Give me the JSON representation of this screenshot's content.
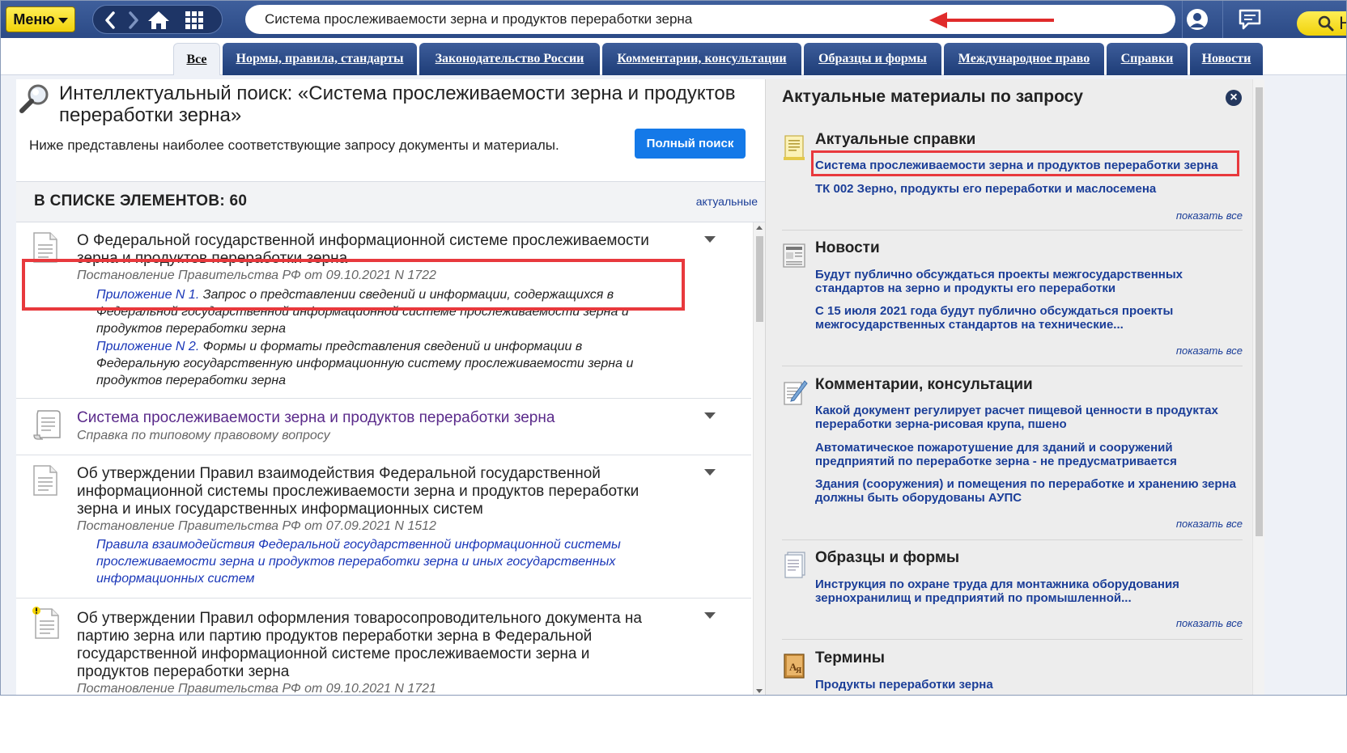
{
  "topbar": {
    "menu_label": "Меню",
    "search_value": "Система прослеживаемости зерна и продуктов переработки зерна",
    "find_label": "Найти",
    "icons": [
      "back-icon",
      "forward-icon",
      "home-icon",
      "grid-icon",
      "search-icon",
      "hamburger-icon",
      "user-icon",
      "chat-icon"
    ]
  },
  "tabs": [
    "Все",
    "Нормы, правила, стандарты",
    "Законодательство России",
    "Комментарии, консультации",
    "Образцы и формы",
    "Международное право",
    "Справки",
    "Новости"
  ],
  "left": {
    "title": "Интеллектуальный поиск: «Система прослеживаемости зерна и продуктов переработки зерна»",
    "subtitle": "Ниже представлены наиболее соответствующие запросу документы и материалы.",
    "full_search_label": "Полный поиск",
    "count_title": "В СПИСКЕ ЭЛЕМЕНТОВ: 60",
    "count_filter": "актуальные",
    "results": [
      {
        "title": "О Федеральной государственной информационной системе прослеживаемости зерна и продуктов переработки зерна",
        "source": "Постановление Правительства РФ от 09.10.2021 N 1722",
        "appendices": [
          {
            "link": "Приложение N 1.",
            "text": " Запрос о представлении сведений и информации, содержащихся в Федеральной государственной информационной системе прослеживаемости зерна и продуктов переработки зерна"
          },
          {
            "link": "Приложение N 2.",
            "text": " Формы и форматы представления сведений и информации в Федеральную государственную информационную систему прослеживаемости зерна и продуктов переработки зерна"
          }
        ]
      },
      {
        "title": "Система прослеживаемости зерна и продуктов переработки зерна",
        "source": "Справка по типовому правовому вопросу"
      },
      {
        "title": "Об утверждении Правил взаимодействия Федеральной государственной информационной системы прослеживаемости зерна и продуктов переработки зерна и иных государственных информационных систем",
        "source": "Постановление Правительства РФ от 07.09.2021 N 1512",
        "appendix_link": "Правила взаимодействия Федеральной государственной информационной системы прослеживаемости зерна и продуктов переработки зерна и иных государственных информационных систем"
      },
      {
        "title": "Об утверждении Правил оформления товаросопроводительного документа на партию зерна или партию продуктов переработки зерна в Федеральной государственной информационной системе прослеживаемости зерна и продуктов переработки зерна",
        "source": "Постановление Правительства РФ от 09.10.2021 N 1721"
      }
    ]
  },
  "right": {
    "title": "Актуальные материалы по запросу",
    "show_all": "показать все",
    "sections": [
      {
        "title": "Актуальные справки",
        "links": [
          "Система прослеживаемости зерна и продуктов переработки зерна",
          "ТК 002 Зерно, продукты его переработки и маслосемена"
        ]
      },
      {
        "title": "Новости",
        "links": [
          "Будут публично обсуждаться проекты межгосударственных стандартов на зерно и продукты его переработки",
          "С 15 июля 2021 года будут публично обсуждаться проекты межгосударственных стандартов на технические..."
        ]
      },
      {
        "title": "Комментарии, консультации",
        "links": [
          "Какой документ регулирует расчет пищевой ценности в продуктах переработки зерна-рисовая крупа, пшено",
          "Автоматическое пожаротушение для зданий и сооружений предприятий по переработке зерна - не предусматривается",
          "Здания (сооружения) и помещения по переработке и хранению зерна должны быть оборудованы АУПС"
        ]
      },
      {
        "title": "Образцы и формы",
        "links": [
          "Инструкция по охране труда для монтажника оборудования зернохранилищ и предприятий по промышленной..."
        ]
      },
      {
        "title": "Термины",
        "links": [
          "Продукты переработки зерна"
        ]
      }
    ]
  },
  "colors": {
    "accent": "#1479e8",
    "topbar": "#2b4a86",
    "highlight": "#e8393d",
    "link": "#1b3e98",
    "yellow": "#f1d20a"
  }
}
